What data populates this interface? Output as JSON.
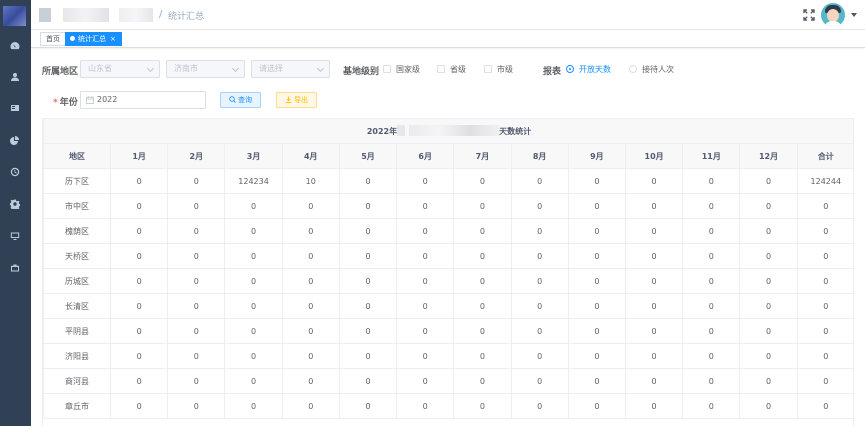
{
  "sidebar": {
    "icons": [
      "dashboard-icon",
      "user-icon",
      "card-icon",
      "chart-icon",
      "clock-icon",
      "settings-icon",
      "monitor-icon",
      "briefcase-icon"
    ]
  },
  "header": {
    "separator": "/",
    "current_page": "统计汇总"
  },
  "tags": {
    "home": "首页",
    "active": "统计汇总",
    "close": "×"
  },
  "filters": {
    "region_label": "所属地区",
    "province_placeholder": "山东省",
    "city_placeholder": "济南市",
    "district_placeholder": "请选择",
    "level_label": "基地级别",
    "levels": [
      "国家级",
      "省级",
      "市级"
    ],
    "report_label": "报表",
    "report_options": [
      "开放天数",
      "接待人次"
    ],
    "report_selected": "开放天数",
    "year_label": "年份",
    "required_mark": "*",
    "year_value": "2022",
    "query_button": "查询",
    "export_button": "导出"
  },
  "table": {
    "title_prefix": "2022年",
    "title_suffix": "天数统计",
    "columns": [
      "地区",
      "1月",
      "2月",
      "3月",
      "4月",
      "5月",
      "6月",
      "7月",
      "8月",
      "9月",
      "10月",
      "11月",
      "12月",
      "合计"
    ],
    "rows": [
      [
        "历下区",
        "0",
        "0",
        "124234",
        "10",
        "0",
        "0",
        "0",
        "0",
        "0",
        "0",
        "0",
        "0",
        "124244"
      ],
      [
        "市中区",
        "0",
        "0",
        "0",
        "0",
        "0",
        "0",
        "0",
        "0",
        "0",
        "0",
        "0",
        "0",
        "0"
      ],
      [
        "槐荫区",
        "0",
        "0",
        "0",
        "0",
        "0",
        "0",
        "0",
        "0",
        "0",
        "0",
        "0",
        "0",
        "0"
      ],
      [
        "天桥区",
        "0",
        "0",
        "0",
        "0",
        "0",
        "0",
        "0",
        "0",
        "0",
        "0",
        "0",
        "0",
        "0"
      ],
      [
        "历城区",
        "0",
        "0",
        "0",
        "0",
        "0",
        "0",
        "0",
        "0",
        "0",
        "0",
        "0",
        "0",
        "0"
      ],
      [
        "长清区",
        "0",
        "0",
        "0",
        "0",
        "0",
        "0",
        "0",
        "0",
        "0",
        "0",
        "0",
        "0",
        "0"
      ],
      [
        "平阴县",
        "0",
        "0",
        "0",
        "0",
        "0",
        "0",
        "0",
        "0",
        "0",
        "0",
        "0",
        "0",
        "0"
      ],
      [
        "济阳县",
        "0",
        "0",
        "0",
        "0",
        "0",
        "0",
        "0",
        "0",
        "0",
        "0",
        "0",
        "0",
        "0"
      ],
      [
        "商河县",
        "0",
        "0",
        "0",
        "0",
        "0",
        "0",
        "0",
        "0",
        "0",
        "0",
        "0",
        "0",
        "0"
      ],
      [
        "章丘市",
        "0",
        "0",
        "0",
        "0",
        "0",
        "0",
        "0",
        "0",
        "0",
        "0",
        "0",
        "0",
        "0"
      ]
    ]
  },
  "colors": {
    "sidebar_bg": "#304156",
    "primary": "#1890ff",
    "warning": "#ffba00"
  }
}
